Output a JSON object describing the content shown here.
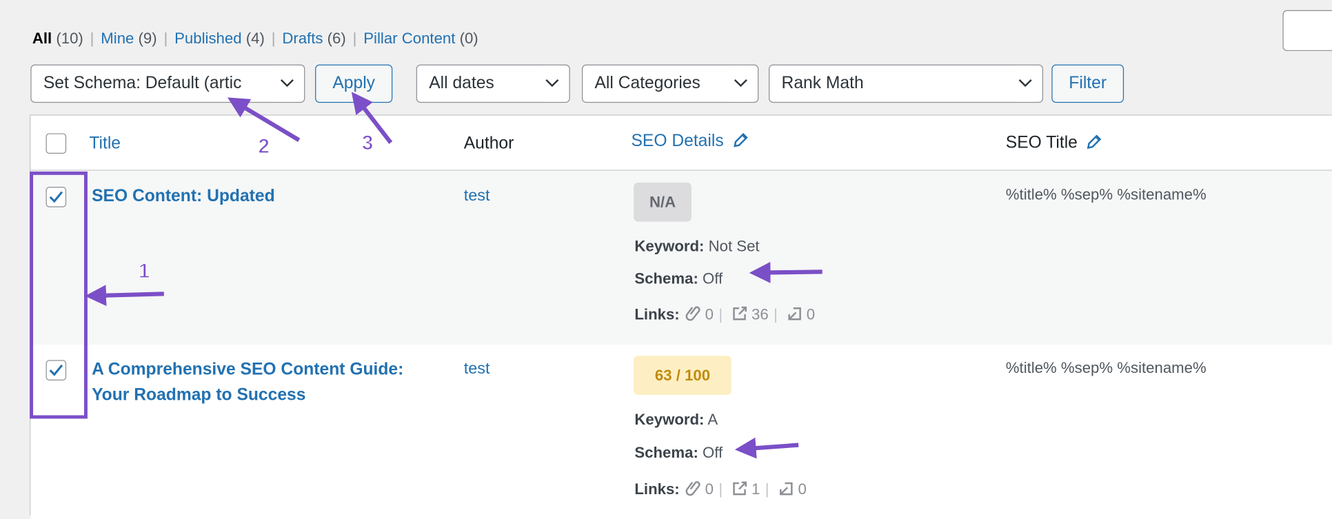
{
  "filters_nav": {
    "items": [
      {
        "label": "All",
        "count": "(10)",
        "current": true
      },
      {
        "label": "Mine",
        "count": "(9)"
      },
      {
        "label": "Published",
        "count": "(4)"
      },
      {
        "label": "Drafts",
        "count": "(6)"
      },
      {
        "label": "Pillar Content",
        "count": "(0)"
      }
    ],
    "separator": "|"
  },
  "toolbar": {
    "bulk_action": "Set Schema: Default (artic",
    "apply_label": "Apply",
    "date_filter": "All dates",
    "category_filter": "All Categories",
    "seo_filter": "Rank Math",
    "filter_label": "Filter"
  },
  "table": {
    "columns": {
      "title": "Title",
      "author": "Author",
      "seo_details": "SEO Details",
      "seo_title": "SEO Title"
    },
    "labels": {
      "keyword": "Keyword:",
      "schema": "Schema:",
      "links": "Links:"
    },
    "rows": [
      {
        "checked": true,
        "title": "SEO Content: Updated",
        "author": "test",
        "score": "N/A",
        "keyword": "Not Set",
        "schema": "Off",
        "links_internal": "0",
        "links_external": "36",
        "links_incoming": "0",
        "seo_title": "%title% %sep% %sitename%"
      },
      {
        "checked": true,
        "title": "A Comprehensive SEO Content Guide: Your Roadmap to Success",
        "author": "test",
        "score": "63 / 100",
        "keyword": "A",
        "schema": "Off",
        "links_internal": "0",
        "links_external": "1",
        "links_incoming": "0",
        "seo_title": "%title% %sep% %sitename%"
      }
    ]
  },
  "annotations": {
    "step1": "1",
    "step2": "2",
    "step3": "3",
    "color": "#7b4fc7"
  },
  "colors": {
    "link": "#2271b1",
    "score_na_bg": "#dcdcde",
    "score_ok_bg": "#fdefc3",
    "score_ok_text": "#c08a0e"
  }
}
